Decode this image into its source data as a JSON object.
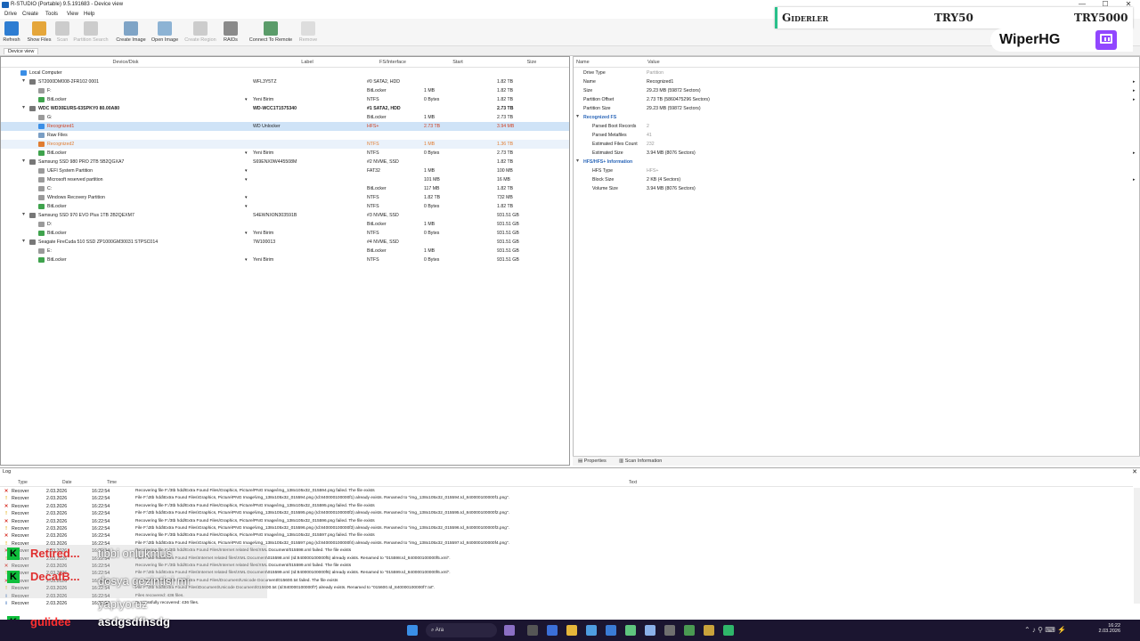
{
  "window": {
    "title": "R-STUDIO (Portable) 9.5.191683 - Device view",
    "controls": [
      "—",
      "☐",
      "✕"
    ]
  },
  "menu": [
    "Drive",
    "Create",
    "Tools",
    "View",
    "Help"
  ],
  "toolbar": [
    {
      "label": "Refresh",
      "icon": "refresh-icon",
      "enabled": true
    },
    {
      "label": "Show Files",
      "icon": "folder-icon",
      "enabled": true
    },
    {
      "label": "Scan",
      "icon": "scan-icon",
      "enabled": false
    },
    {
      "label": "Partition Search",
      "icon": "partition-search-icon",
      "enabled": false
    },
    {
      "label": "Create Image",
      "icon": "create-image-icon",
      "enabled": true
    },
    {
      "label": "Open Image",
      "icon": "open-image-icon",
      "enabled": true
    },
    {
      "label": "Create Region",
      "icon": "create-region-icon",
      "enabled": false
    },
    {
      "label": "RAIDs",
      "icon": "raid-icon",
      "enabled": true
    },
    {
      "label": "Connect To Remote",
      "icon": "connect-remote-icon",
      "enabled": true
    },
    {
      "label": "Remove",
      "icon": "remove-icon",
      "enabled": false
    }
  ],
  "view_tab": "Device view",
  "device_columns": [
    "Device/Disk",
    "Label",
    "FS/Interface",
    "Start",
    "Size"
  ],
  "devices": [
    {
      "name": "Local Computer",
      "label": "",
      "fs": "",
      "start": "",
      "size": "",
      "level": 0,
      "expander": "",
      "kind": "computer"
    },
    {
      "name": "ST2000DM008-2FR102 0001",
      "label": "WFL3Y5TZ",
      "fs": "#0 SATA2, HDD",
      "start": "",
      "size": "1.82 TB",
      "level": 1,
      "expander": "▾",
      "kind": "disk"
    },
    {
      "name": "F:",
      "label": "",
      "fs": "BitLocker",
      "start": "1 MB",
      "size": "1.82 TB",
      "level": 2,
      "expander": "",
      "kind": "part"
    },
    {
      "name": "BitLocker",
      "label": "Yeni Birim",
      "fs": "NTFS",
      "start": "0 Bytes",
      "size": "1.82 TB",
      "level": 2,
      "expander": "",
      "kind": "vol",
      "dropdown": true
    },
    {
      "name": "WDC WD30EURS-63SPKY0 80.00A80",
      "label": "WD-WCC1T1575340",
      "fs": "#1 SATA2, HDD",
      "start": "",
      "size": "2.73 TB",
      "level": 1,
      "expander": "▾",
      "kind": "disk",
      "bold": true
    },
    {
      "name": "G:",
      "label": "",
      "fs": "BitLocker",
      "start": "1 MB",
      "size": "2.73 TB",
      "level": 2,
      "expander": "",
      "kind": "part"
    },
    {
      "name": "Recognized1",
      "label": "WD Unlocker",
      "fs": "HFS+",
      "start": "2.73 TB",
      "size": "3.94 MB",
      "level": 2,
      "expander": "",
      "kind": "rec",
      "selected": true
    },
    {
      "name": "Raw Files",
      "label": "",
      "fs": "",
      "start": "",
      "size": "",
      "level": 2,
      "expander": "",
      "kind": "raw"
    },
    {
      "name": "Recognized2",
      "label": "",
      "fs": "NTFS",
      "start": "1 MB",
      "size": "1.36 TB",
      "level": 2,
      "expander": "",
      "kind": "rec2",
      "hover": true
    },
    {
      "name": "BitLocker",
      "label": "Yeni Birim",
      "fs": "NTFS",
      "start": "0 Bytes",
      "size": "2.73 TB",
      "level": 2,
      "expander": "",
      "kind": "vol",
      "dropdown": true
    },
    {
      "name": "Samsung SSD 980 PRO 2TB 5B2QGXA7",
      "label": "S69ENX0W445508M",
      "fs": "#2 NVME, SSD",
      "start": "",
      "size": "1.82 TB",
      "level": 1,
      "expander": "▾",
      "kind": "disk"
    },
    {
      "name": "UEFI System Partition",
      "label": "",
      "fs": "FAT32",
      "start": "1 MB",
      "size": "100 MB",
      "level": 2,
      "expander": "",
      "kind": "part",
      "dropdown": true
    },
    {
      "name": "Microsoft reserved partition",
      "label": "",
      "fs": "",
      "start": "101 MB",
      "size": "16 MB",
      "level": 2,
      "expander": "",
      "kind": "part",
      "dropdown": true
    },
    {
      "name": "C:",
      "label": "",
      "fs": "BitLocker",
      "start": "117 MB",
      "size": "1.82 TB",
      "level": 2,
      "expander": "",
      "kind": "part"
    },
    {
      "name": "Windows Recovery Partition",
      "label": "",
      "fs": "NTFS",
      "start": "1.82 TB",
      "size": "732 MB",
      "level": 2,
      "expander": "",
      "kind": "part",
      "dropdown": true
    },
    {
      "name": "BitLocker",
      "label": "",
      "fs": "NTFS",
      "start": "0 Bytes",
      "size": "1.82 TB",
      "level": 2,
      "expander": "",
      "kind": "vol",
      "dropdown": true
    },
    {
      "name": "Samsung SSD 970 EVO Plus 1TB 2B2QEXM7",
      "label": "S4EWNX0N303591B",
      "fs": "#3 NVME, SSD",
      "start": "",
      "size": "931.51 GB",
      "level": 1,
      "expander": "▾",
      "kind": "disk"
    },
    {
      "name": "D:",
      "label": "",
      "fs": "BitLocker",
      "start": "1 MB",
      "size": "931.51 GB",
      "level": 2,
      "expander": "",
      "kind": "part"
    },
    {
      "name": "BitLocker",
      "label": "Yeni Birim",
      "fs": "NTFS",
      "start": "0 Bytes",
      "size": "931.51 GB",
      "level": 2,
      "expander": "",
      "kind": "vol",
      "dropdown": true
    },
    {
      "name": "Seagate FireCuda 510 SSD ZP1000GM30031 STPSC014",
      "label": "7W100013",
      "fs": "#4 NVME, SSD",
      "start": "",
      "size": "931.51 GB",
      "level": 1,
      "expander": "▾",
      "kind": "disk"
    },
    {
      "name": "E:",
      "label": "",
      "fs": "BitLocker",
      "start": "1 MB",
      "size": "931.51 GB",
      "level": 2,
      "expander": "",
      "kind": "part"
    },
    {
      "name": "BitLocker",
      "label": "Yeni Birim",
      "fs": "NTFS",
      "start": "0 Bytes",
      "size": "931.51 GB",
      "level": 2,
      "expander": "",
      "kind": "vol",
      "dropdown": true
    }
  ],
  "property_columns": [
    "Name",
    "Value"
  ],
  "properties": [
    {
      "name": "Drive Type",
      "value": "Partition",
      "indent": 1,
      "grey": true
    },
    {
      "name": "Name",
      "value": "Recognized1",
      "indent": 1,
      "arrow": true
    },
    {
      "name": "Size",
      "value": "29.23 MB (59872 Sectors)",
      "indent": 1,
      "arrow": true
    },
    {
      "name": "Partition Offset",
      "value": "2.73 TB (5860475296 Sectors)",
      "indent": 1,
      "arrow": true
    },
    {
      "name": "Partition Size",
      "value": "29.23 MB (59872 Sectors)",
      "indent": 1
    },
    {
      "name": "Recognized FS",
      "value": "",
      "indent": 0,
      "section": true
    },
    {
      "name": "Parsed Boot Records",
      "value": "2",
      "indent": 2,
      "grey": true
    },
    {
      "name": "Parsed Metafiles",
      "value": "41",
      "indent": 2,
      "grey": true
    },
    {
      "name": "Estimated Files Count",
      "value": "232",
      "indent": 2,
      "grey": true
    },
    {
      "name": "Estimated Size",
      "value": "3.94 MB (8076 Sectors)",
      "indent": 2,
      "arrow": true
    },
    {
      "name": "HFS/HFS+ Information",
      "value": "",
      "indent": 0,
      "section": true
    },
    {
      "name": "HFS Type",
      "value": "HFS+",
      "indent": 2,
      "grey": true
    },
    {
      "name": "Block Size",
      "value": "2 KB (4 Sectors)",
      "indent": 2,
      "arrow": true
    },
    {
      "name": "Volume Size",
      "value": "3.94 MB (8076 Sectors)",
      "indent": 2
    }
  ],
  "bottom_tabs": [
    "Properties",
    "Scan Information"
  ],
  "log": {
    "title": "Log",
    "columns": [
      "Type",
      "Date",
      "Time",
      "Text"
    ],
    "rows": [
      {
        "type": "Recover",
        "date": "2.03.2026",
        "time": "16:22:54",
        "icon": "error",
        "text": "Recovering file F:/3tb hdd/Extra Found Files/Graphics, Picture/PNG Image/img_138x105x32_015594.png failed. The file exists"
      },
      {
        "type": "Recover",
        "date": "2.03.2026",
        "time": "16:22:54",
        "icon": "warn",
        "text": "File F:\\3tb hdd\\Extra Found Files\\Graphics, Picture\\PNG Image\\img_138x105x32_015594.png (Id:840000100000f1) already exists. Renamed to \"img_138x105x32_015594.Id_840000100000f1.png\"."
      },
      {
        "type": "Recover",
        "date": "2.03.2026",
        "time": "16:22:54",
        "icon": "error",
        "text": "Recovering file F:/3tb hdd/Extra Found Files/Graphics, Picture/PNG Image/img_138x105x32_015595.png failed. The file exists"
      },
      {
        "type": "Recover",
        "date": "2.03.2026",
        "time": "16:22:54",
        "icon": "warn",
        "text": "File F:\\3tb hdd\\Extra Found Files\\Graphics, Picture\\PNG Image\\img_138x105x32_015595.png (Id:840000100000f2) already exists. Renamed to \"img_138x105x32_015595.Id_840000100000f2.png\"."
      },
      {
        "type": "Recover",
        "date": "2.03.2026",
        "time": "16:22:54",
        "icon": "error",
        "text": "Recovering file F:/3tb hdd/Extra Found Files/Graphics, Picture/PNG Image/img_138x105x32_015596.png failed. The file exists"
      },
      {
        "type": "Recover",
        "date": "2.03.2026",
        "time": "16:22:54",
        "icon": "warn",
        "text": "File F:\\3tb hdd\\Extra Found Files\\Graphics, Picture\\PNG Image\\img_138x105x32_015596.png (Id:840000100000f3) already exists. Renamed to \"img_138x105x32_015596.Id_840000100000f3.png\"."
      },
      {
        "type": "Recover",
        "date": "2.03.2026",
        "time": "16:22:54",
        "icon": "error",
        "text": "Recovering file F:/3tb hdd/Extra Found Files/Graphics, Picture/PNG Image/img_138x105x32_015597.png failed. The file exists"
      },
      {
        "type": "Recover",
        "date": "2.03.2026",
        "time": "16:22:54",
        "icon": "warn",
        "text": "File F:\\3tb hdd\\Extra Found Files\\Graphics, Picture\\PNG Image\\img_138x105x32_015597.png (Id:840000100000f4) already exists. Renamed to \"img_138x105x32_015597.Id_840000100000f4.png\"."
      },
      {
        "type": "Recover",
        "date": "2.03.2026",
        "time": "16:22:54",
        "icon": "error",
        "text": "Recovering file F:/3tb hdd/Extra Found Files/Internet related files/XML Document/015598.xml failed. The file exists"
      },
      {
        "type": "Recover",
        "date": "2.03.2026",
        "time": "16:22:54",
        "icon": "warn",
        "text": "File F:\\3tb hdd\\Extra Found Files\\Internet related files\\XML Document\\015598.xml (Id:840000100000f5) already exists. Renamed to \"015598.Id_840000100000f5.xml\"."
      },
      {
        "type": "Recover",
        "date": "2.03.2026",
        "time": "16:22:54",
        "icon": "error",
        "text": "Recovering file F:/3tb hdd/Extra Found Files/Internet related files/XML Document/015599.xml failed. The file exists"
      },
      {
        "type": "Recover",
        "date": "2.03.2026",
        "time": "16:22:54",
        "icon": "warn",
        "text": "File F:\\3tb hdd\\Extra Found Files\\Internet related files\\XML Document\\015599.xml (Id:840000100000f6) already exists. Renamed to \"015599.Id_840000100000f6.xml\"."
      },
      {
        "type": "Recover",
        "date": "2.03.2026",
        "time": "16:22:54",
        "icon": "error",
        "text": "Recovering file F:/3tb hdd/Extra Found Files/Document/Unicode Document/015600.txt failed. The file exists"
      },
      {
        "type": "Recover",
        "date": "2.03.2026",
        "time": "16:22:54",
        "icon": "warn",
        "text": "File F:\\3tb hdd\\Extra Found Files\\Document\\Unicode Document\\015600.txt (Id:840000100000f7) already exists. Renamed to \"015600.Id_840000100000f7.txt\"."
      },
      {
        "type": "Recover",
        "date": "2.03.2026",
        "time": "16:22:54",
        "icon": "info",
        "text": "Files recovered: 436 files."
      },
      {
        "type": "Recover",
        "date": "2.03.2026",
        "time": "16:22:54",
        "icon": "info",
        "text": "Successfully recovered: 436 files."
      }
    ]
  },
  "overlay": {
    "label": "Giderler",
    "amount1": "TRY50",
    "amount2": "TRY5000",
    "channel": "WiperHG",
    "accent": "#28c08a",
    "twitch_color": "#9146ff"
  },
  "chat": [
    {
      "user": "Retired...",
      "message": "tibbi onlukmus",
      "user_color": "#e03030"
    },
    {
      "user": "DecafB...",
      "message": "dosya gezintisi mi yapiyoruz",
      "user_color": "#e03030"
    },
    {
      "user": "gulidee",
      "message": "asdgsdfhsdg",
      "user_color": "#ff3030"
    }
  ],
  "taskbar": {
    "search": "Ara",
    "time": "16:22",
    "date": "2.03.2026"
  }
}
